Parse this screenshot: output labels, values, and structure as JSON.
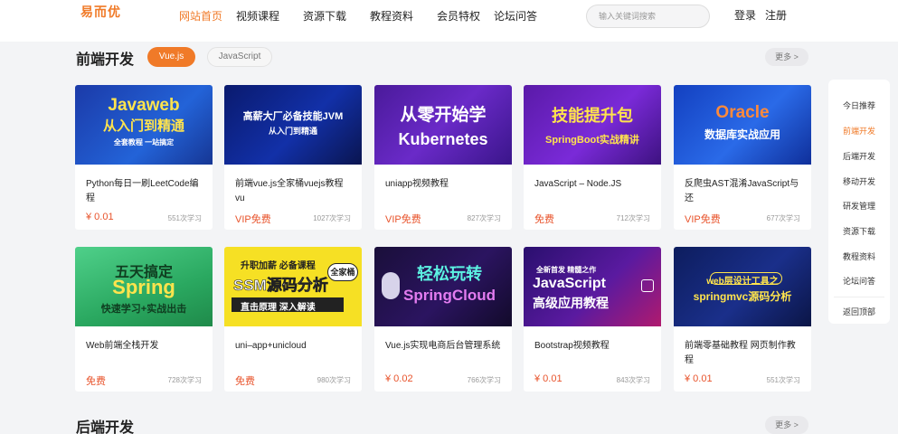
{
  "header": {
    "logo": "易而优",
    "nav": [
      "网站首页",
      "视频课程",
      "资源下载",
      "教程资料",
      "会员特权",
      "论坛问答"
    ],
    "active_nav": 0,
    "search_placeholder": "输入关键词搜索",
    "login": "登录",
    "register": "注册"
  },
  "section1": {
    "title": "前端开发",
    "tabs": [
      "Vue.js",
      "JavaScript"
    ],
    "more": "更多 >",
    "row1": [
      {
        "thumb_line1": "Javaweb",
        "thumb_line2": "从入门到精通",
        "thumb_line3": "全套教程 一站搞定",
        "title": "Python每日一刷LeetCode编程",
        "price": "¥ 0.01",
        "learners": "551次学习"
      },
      {
        "thumb_line1": "高薪大厂必备技能JVM",
        "thumb_line2": "从入门到精通",
        "title": "前端vue.js全家桶vuejs教程vu",
        "price": "VIP免费",
        "learners": "1027次学习"
      },
      {
        "thumb_line1": "从零开始学",
        "thumb_line2": "Kubernetes",
        "title": "uniapp视频教程",
        "price": "VIP免费",
        "learners": "827次学习"
      },
      {
        "thumb_line1": "技能提升包",
        "thumb_line2": "SpringBoot实战精讲",
        "title": "JavaScript – Node.JS",
        "price": "免费",
        "learners": "712次学习"
      },
      {
        "thumb_line1": "Oracle",
        "thumb_line2": "数据库实战应用",
        "title": "反爬虫AST混淆JavaScript与还",
        "price": "VIP免费",
        "learners": "677次学习"
      }
    ],
    "row2": [
      {
        "thumb_line1": "五天搞定",
        "thumb_line2": "Spring",
        "thumb_line3": "快速学习+实战出击",
        "title": "Web前端全栈开发",
        "price": "免费",
        "learners": "728次学习"
      },
      {
        "thumb_line1": "升职加薪 必备课程",
        "thumb_line2": "SSM源码分析",
        "thumb_line3": "直击原理 深入解读",
        "thumb_badge": "全家桶",
        "title": "uni–app+unicloud",
        "price": "免费",
        "learners": "980次学习"
      },
      {
        "thumb_line1": "轻松玩转",
        "thumb_line2": "SpringCloud",
        "title": "Vue.js实现电商后台管理系统",
        "price": "¥ 0.02",
        "learners": "766次学习"
      },
      {
        "thumb_line1": "全新首发 精髓之作",
        "thumb_line2": "JavaScript",
        "thumb_line3": "高级应用教程",
        "title": "Bootstrap视频教程",
        "price": "¥ 0.01",
        "learners": "843次学习"
      },
      {
        "thumb_line1": "web层设计工具之",
        "thumb_line2": "springmvc源码分析",
        "title": "前端零基础教程 网页制作教程",
        "price": "¥ 0.01",
        "learners": "551次学习"
      }
    ]
  },
  "section2": {
    "title": "后端开发",
    "more": "更多 >"
  },
  "sidebar": {
    "items": [
      "今日推荐",
      "前端开发",
      "后端开发",
      "移动开发",
      "研发管理",
      "资源下载",
      "教程资料",
      "论坛问答"
    ],
    "active": 1,
    "back_top": "返回顶部"
  }
}
